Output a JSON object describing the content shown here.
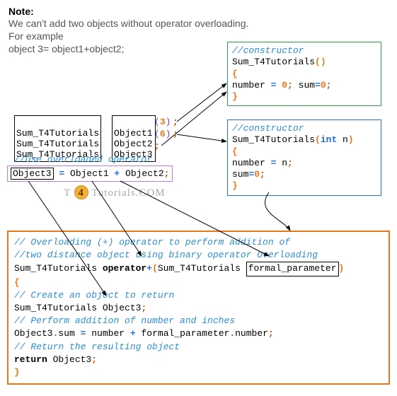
{
  "note": {
    "label": "Note:",
    "line1": "We can't add two objects without operator overloading.",
    "line2": "For example",
    "line3": "object 3= object1+object2;"
  },
  "decl": {
    "type": "Sum_T4Tutorials",
    "obj1": "Object1",
    "obj2": "Object2",
    "obj3": "Object3",
    "arg1_open": "(",
    "arg1_val": "3",
    "arg1_close": ")",
    "arg2_open": "(",
    "arg2_val": "6",
    "arg2_close": ")",
    "semi": ";"
  },
  "use_comment": "//Use overloaded operator",
  "assign": {
    "lhs": "Object3",
    "eq": " = ",
    "a": "Object1",
    "plus": " + ",
    "b": "Object2",
    "semi": ";"
  },
  "watermark": {
    "pre": "T ",
    "num": "4",
    "post": " Tutorials",
    "dot": ".COM"
  },
  "ctor1": {
    "comment": "//constructor",
    "name": "Sum_T4Tutorials",
    "parens": "()",
    "open": "{",
    "body_a": "number ",
    "body_eq": "=",
    "body_b": " 0",
    "body_semi": ";",
    "body_c": " sum",
    "body_eq2": "=",
    "body_d": "0",
    "body_semi2": ";",
    "close": "}"
  },
  "ctor2": {
    "comment": "//constructor",
    "name": "Sum_T4Tutorials",
    "po": "(",
    "int": "int",
    "n": " n",
    "pc": ")",
    "open": "{",
    "l1a": "number ",
    "l1eq": "=",
    "l1b": " n",
    "l1semi": ";",
    "l2a": "sum",
    "l2eq": "=",
    "l2b": "0",
    "l2semi": ";",
    "close": "}"
  },
  "op": {
    "c1": "// Overloading (+) operator to perform addition of",
    "c2": "//two distance object using binary operator Overloading",
    "ret": "Sum_T4Tutorials ",
    "opkw": "operator",
    "plus": "+",
    "po": "(",
    "param_type": "Sum_T4Tutorials ",
    "param_name": "formal_parameter",
    "pc": ")",
    "open": "{",
    "c3": "// Create an object to return",
    "decl": "Sum_T4Tutorials Object3",
    "semi": ";",
    "c4": "// Perform addition of number and inches",
    "l_a": "Object3",
    "l_dot": ".",
    "l_b": "sum ",
    "l_eq": "=",
    "l_c": " number ",
    "l_plus": "+",
    "l_d": " formal_parameter",
    "l_dot2": ".",
    "l_e": "number",
    "l_semi": ";",
    "c5": "// Return the resulting object",
    "retkw": "return",
    "reto": " Object3",
    "retsemi": ";",
    "close": "}"
  }
}
